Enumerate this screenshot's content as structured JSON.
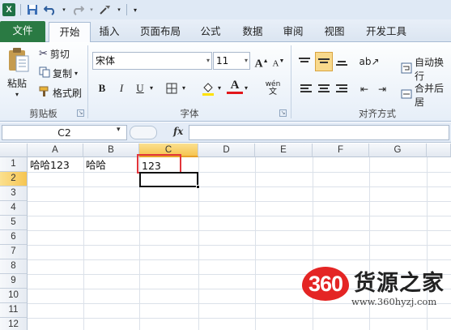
{
  "quick_access": {
    "app_icon": "excel-icon",
    "icons": [
      "save-icon",
      "undo-icon",
      "redo-icon",
      "customize-icon"
    ]
  },
  "tabs": [
    "文件",
    "开始",
    "插入",
    "页面布局",
    "公式",
    "数据",
    "审阅",
    "视图",
    "开发工具"
  ],
  "ribbon": {
    "clipboard": {
      "paste": "粘贴",
      "cut": "剪切",
      "copy": "复制",
      "format_painter": "格式刷",
      "label": "剪贴板"
    },
    "font": {
      "name": "宋体",
      "size": "11",
      "bold": "B",
      "italic": "I",
      "underline": "U",
      "font_color_glyph": "A",
      "grow": "A",
      "shrink": "A",
      "phonetic": "wén",
      "label": "字体"
    },
    "alignment": {
      "wrap_text": "自动换行",
      "merge_center": "合并后居",
      "label": "对齐方式"
    }
  },
  "formula_bar": {
    "name_box": "C2",
    "fx": "fx",
    "formula": ""
  },
  "columns": [
    "A",
    "B",
    "C",
    "D",
    "E",
    "F",
    "G"
  ],
  "rows": [
    "1",
    "2",
    "3",
    "4",
    "5",
    "6",
    "7",
    "8",
    "9",
    "10",
    "11",
    "12"
  ],
  "cells": {
    "A1": "哈哈123",
    "B1": "哈哈",
    "C1": "123"
  },
  "active_cell": "C2",
  "colors": {
    "accent": "#1e7145",
    "highlight": "#e2353a",
    "selection_header": "#f6c552"
  },
  "watermark": {
    "badge": "360",
    "name": "货源之家",
    "url": "www.360hyzj.com"
  }
}
